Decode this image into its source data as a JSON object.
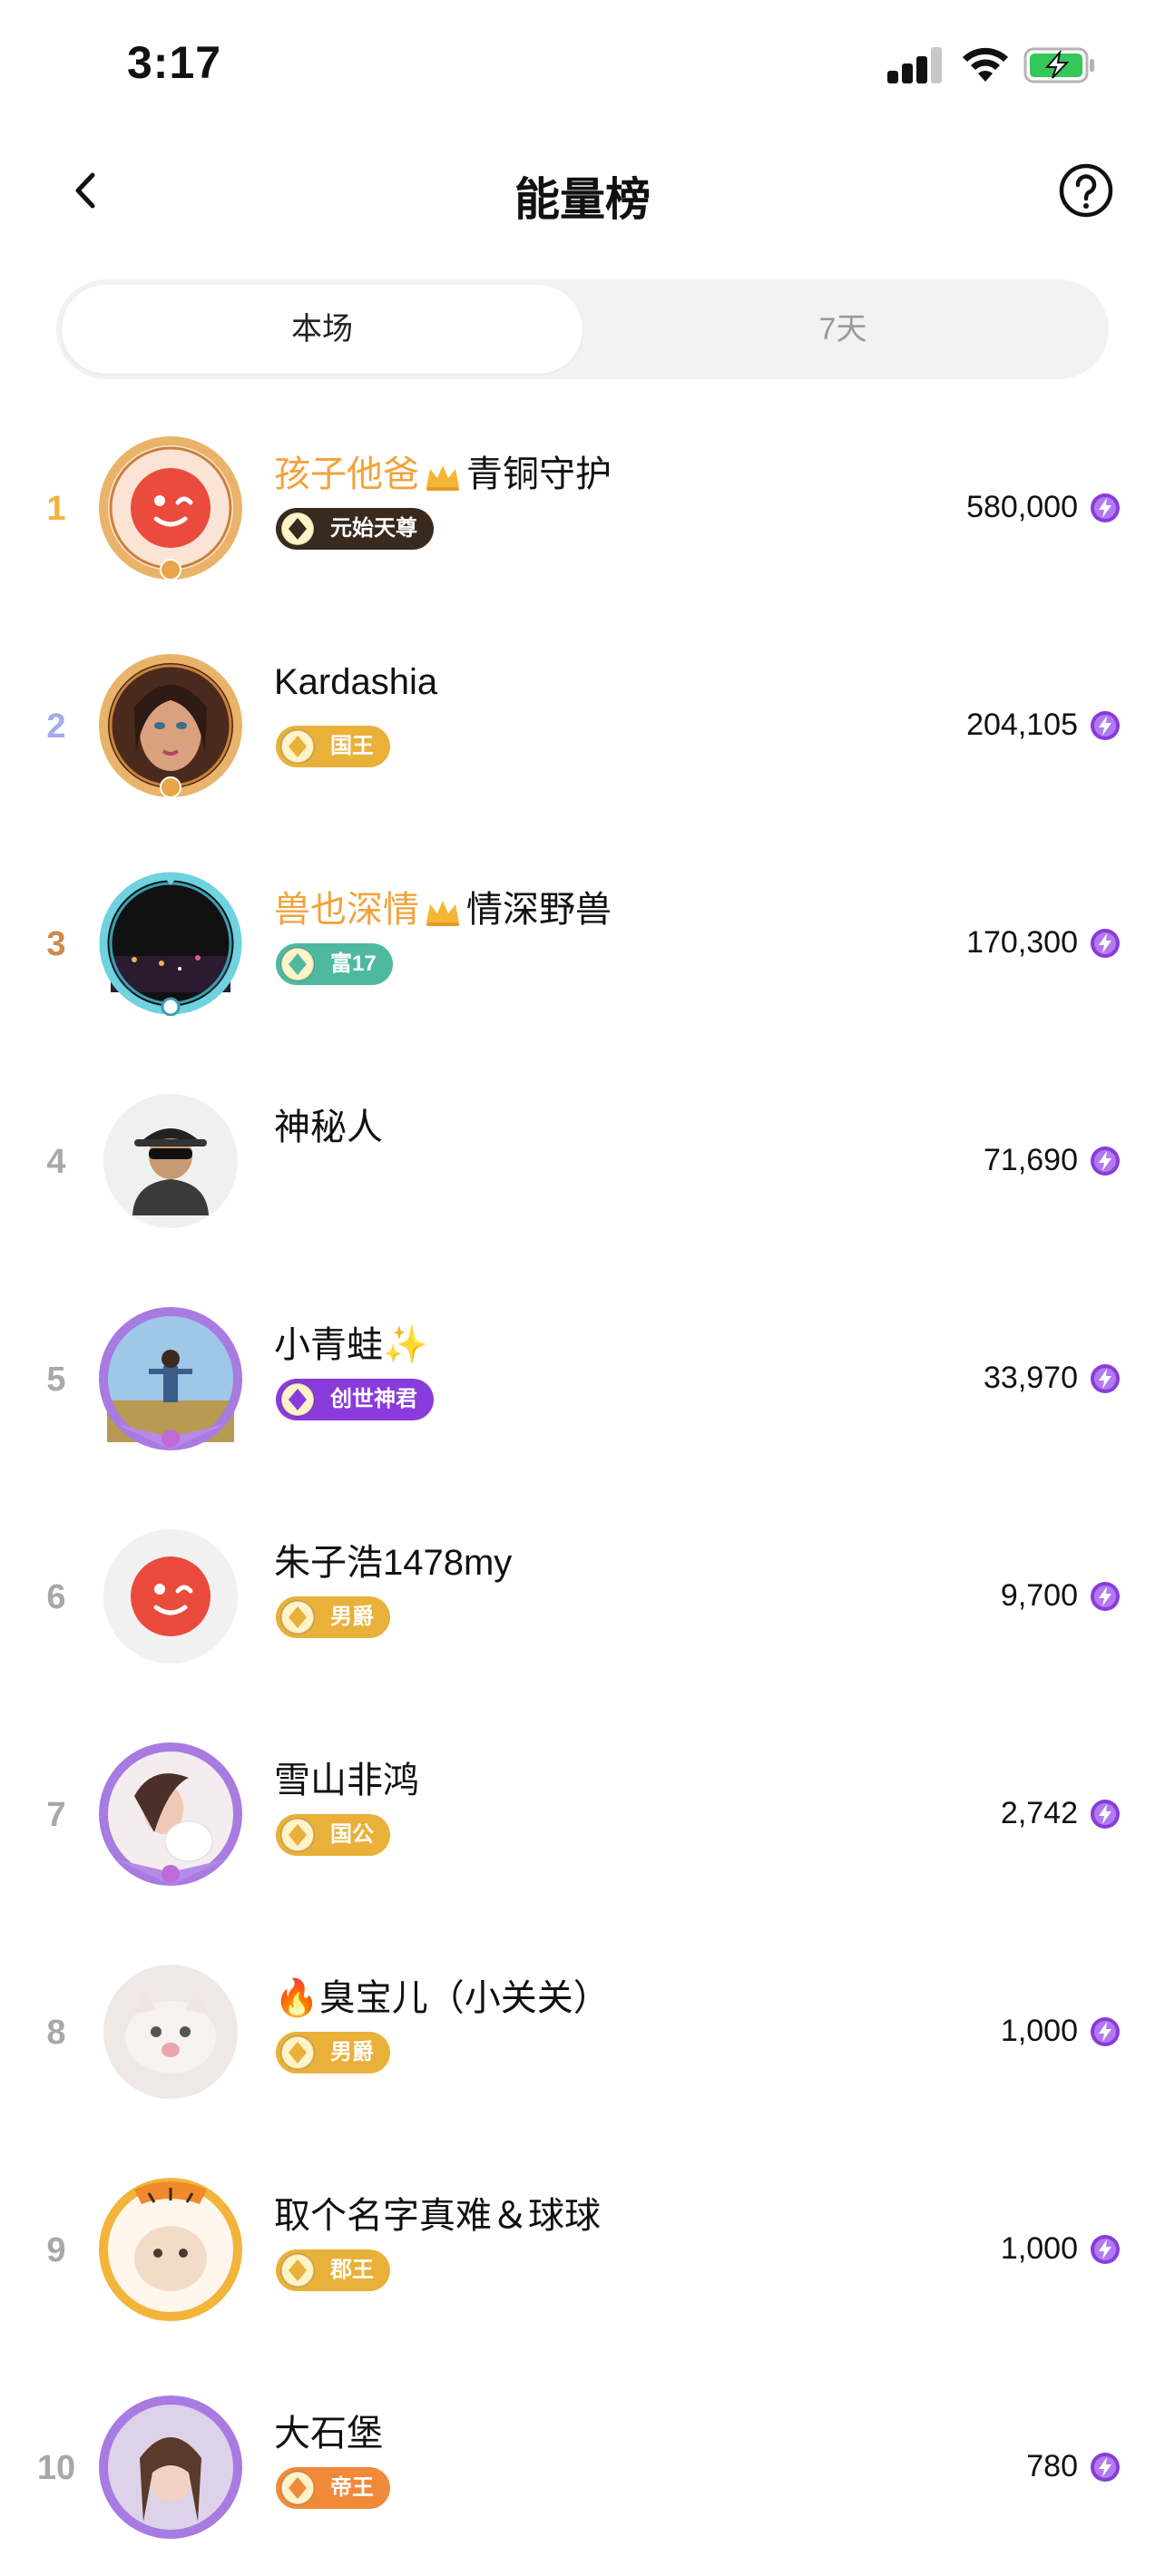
{
  "status_bar": {
    "time": "3:17"
  },
  "header": {
    "title": "能量榜"
  },
  "tabs": [
    {
      "label": "本场",
      "active": true
    },
    {
      "label": "7天",
      "active": false
    }
  ],
  "colors": {
    "gold": "#f2a23b",
    "energy": "#8a3bdb"
  },
  "ranking": [
    {
      "rank": "1",
      "rank_color": "#f5b13c",
      "name": "孩子他爸",
      "name_gold": true,
      "crown": true,
      "suffix": "青铜守护",
      "badge": "元始天尊",
      "badge_bg": "#3a2a1e",
      "score": "580,000",
      "avatar": "logo-red"
    },
    {
      "rank": "2",
      "rank_color": "#a4a9ea",
      "name": "Kardashia",
      "name_gold": false,
      "crown": false,
      "suffix": "",
      "badge": "国王",
      "badge_bg": "#e9b03a",
      "score": "204,105",
      "avatar": "photo-woman"
    },
    {
      "rank": "3",
      "rank_color": "#d08a4a",
      "name": "兽也深情",
      "name_gold": true,
      "crown": true,
      "suffix": "情深野兽",
      "badge": "富17",
      "badge_bg": "#4fb99f",
      "score": "170,300",
      "avatar": "photo-night"
    },
    {
      "rank": "4",
      "rank_color": "#a8a8a8",
      "name": "神秘人",
      "name_gold": false,
      "crown": false,
      "suffix": "",
      "badge": "",
      "badge_bg": "",
      "score": "71,690",
      "avatar": "mystery"
    },
    {
      "rank": "5",
      "rank_color": "#a8a8a8",
      "name": "小青蛙✨",
      "name_gold": false,
      "crown": false,
      "suffix": "",
      "badge": "创世神君",
      "badge_bg": "#8a3bdb",
      "score": "33,970",
      "avatar": "photo-sky"
    },
    {
      "rank": "6",
      "rank_color": "#a8a8a8",
      "name": "朱子浩1478my",
      "name_gold": false,
      "crown": false,
      "suffix": "",
      "badge": "男爵",
      "badge_bg": "#e9b03a",
      "score": "9,700",
      "avatar": "logo-red-plain"
    },
    {
      "rank": "7",
      "rank_color": "#a8a8a8",
      "name": "雪山非鸿",
      "name_gold": false,
      "crown": false,
      "suffix": "",
      "badge": "国公",
      "badge_bg": "#e9b03a",
      "score": "2,742",
      "avatar": "photo-girl"
    },
    {
      "rank": "8",
      "rank_color": "#a8a8a8",
      "name": "🔥臭宝儿（小关关）",
      "name_gold": false,
      "crown": false,
      "suffix": "",
      "badge": "男爵",
      "badge_bg": "#e9b03a",
      "score": "1,000",
      "avatar": "photo-cat"
    },
    {
      "rank": "9",
      "rank_color": "#a8a8a8",
      "name": "取个名字真难＆球球",
      "name_gold": false,
      "crown": false,
      "suffix": "",
      "badge": "郡王",
      "badge_bg": "#e9b03a",
      "score": "1,000",
      "avatar": "photo-tiger"
    },
    {
      "rank": "10",
      "rank_color": "#a8a8a8",
      "name": "大石堡",
      "name_gold": false,
      "crown": false,
      "suffix": "",
      "badge": "帝王",
      "badge_bg": "#f08a3a",
      "score": "780",
      "avatar": "photo-girl2"
    }
  ]
}
